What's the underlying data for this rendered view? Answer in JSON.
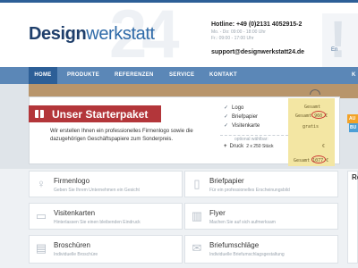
{
  "header": {
    "logo_bold": "Design",
    "logo_rest": "werkstatt",
    "logo_number": "24",
    "hotline": "Hotline: +49 (0)2131 4052915-2",
    "hours": [
      "Mo. - Do: 09:00 - 18:00 Uhr",
      "Fr.: 09:00 - 17:00 Uhr"
    ],
    "email": "support@designwerkstatt24.de",
    "side_fragment": "En"
  },
  "nav": {
    "items": [
      "HOME",
      "PRODUKTE",
      "REFERENZEN",
      "SERVICE",
      "KONTAKT"
    ],
    "cut_item": "K"
  },
  "starter": {
    "title": "Unser Starterpaket",
    "description": "Wir erstellen Ihnen ein professionelles Firmenlogo sowie die dazugehörigen Geschäftspapiere zum Sonderpreis.",
    "included": [
      "Logo",
      "Briefpapier",
      "Visitenkarte"
    ],
    "optional_label": "optional wählbar:",
    "druck_label": "Druck",
    "druck_qty": "2 x 250 Stück",
    "note_lines": [
      "Gesamt",
      "Gesamt 960 €",
      "gratis",
      "€",
      "Gesamt 1077 €"
    ],
    "badges": [
      "AU",
      "BU"
    ]
  },
  "services": [
    {
      "title": "Firmenlogo",
      "subtitle": "Geben Sie Ihrem Unternehmen ein Gesicht",
      "icon": "lightbulb-icon"
    },
    {
      "title": "Briefpapier",
      "subtitle": "Für ein professionelles Erscheinungsbild",
      "icon": "document-icon"
    },
    {
      "title": "Visitenkarten",
      "subtitle": "Hinterlassen Sie einen bleibenden Eindruck",
      "icon": "cards-icon"
    },
    {
      "title": "Flyer",
      "subtitle": "Machen Sie auf sich aufmerksam",
      "icon": "map-icon"
    },
    {
      "title": "Broschüren",
      "subtitle": "Individuelle Broschüre",
      "icon": "book-icon"
    },
    {
      "title": "Briefumschläge",
      "subtitle": "Individuelle Briefumschlagsgestaltung",
      "icon": "envelope-icon"
    }
  ],
  "sidebar_fragment": "Re",
  "colors": {
    "brand_dark": "#1f3f6b",
    "nav_bg": "#5b87b7",
    "nav_active": "#2d5f97",
    "banner_red": "#b3363a",
    "note_yellow": "#f3e6a3"
  }
}
